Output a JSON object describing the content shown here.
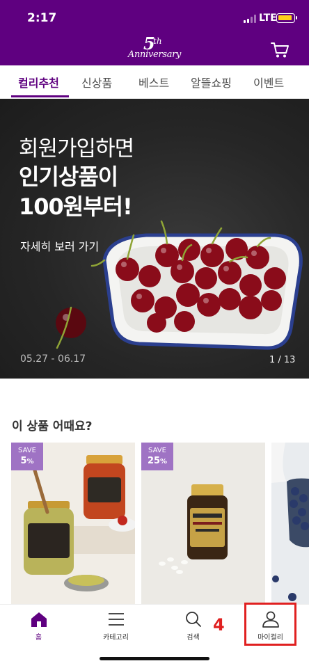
{
  "status_bar": {
    "time": "2:17",
    "network": "LTE"
  },
  "header": {
    "logo_number": "5",
    "logo_suffix": "th",
    "logo_text": "Anniversary",
    "cart_icon": "cart-icon"
  },
  "tabs": [
    {
      "label": "컬리추천",
      "active": true
    },
    {
      "label": "신상품",
      "active": false
    },
    {
      "label": "베스트",
      "active": false
    },
    {
      "label": "알뜰쇼핑",
      "active": false
    },
    {
      "label": "이벤트",
      "active": false
    }
  ],
  "banner": {
    "line1": "회원가입하면",
    "line2": "인기상품이",
    "line3": "100원부터!",
    "link": "자세히 보러 가기",
    "period": "05.27 - 06.17",
    "page": "1 / 13"
  },
  "recommend": {
    "title": "이 상품 어때요?",
    "products": [
      {
        "save_label": "SAVE",
        "discount": "5",
        "unit": "%"
      },
      {
        "save_label": "SAVE",
        "discount": "25",
        "unit": "%"
      }
    ]
  },
  "bottom_nav": [
    {
      "label": "홈",
      "icon": "home-icon",
      "active": true
    },
    {
      "label": "카테고리",
      "icon": "menu-icon",
      "active": false
    },
    {
      "label": "검색",
      "icon": "search-icon",
      "active": false
    },
    {
      "label": "마이컬리",
      "icon": "user-icon",
      "active": false
    }
  ],
  "annotation": {
    "step": "4"
  },
  "colors": {
    "brand": "#5f0080",
    "save_badge": "#9f73c4",
    "annotation": "#e02020"
  }
}
